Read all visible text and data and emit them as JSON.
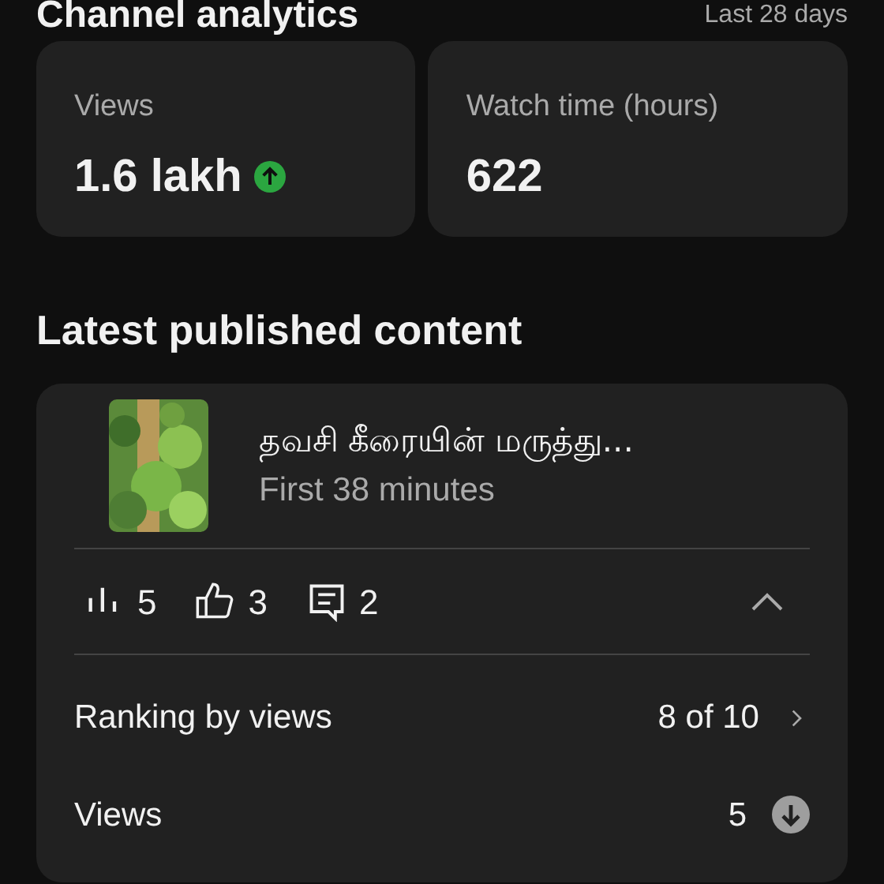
{
  "header": {
    "title": "Channel analytics",
    "period": "Last 28 days"
  },
  "summary_cards": [
    {
      "label": "Views",
      "value": "1.6 lakh",
      "kind": "increase"
    },
    {
      "label": "Watch time (hours)",
      "value": "622",
      "kind": "plain"
    }
  ],
  "latest": {
    "heading": "Latest published content",
    "video": {
      "title": "தவசி கீரையின் மருத்து...",
      "subtitle": "First 38 minutes"
    },
    "stats": [
      {
        "kind": "views",
        "value": "5"
      },
      {
        "kind": "likes",
        "value": "3"
      },
      {
        "kind": "comments",
        "value": "2"
      }
    ],
    "expanded": true,
    "rows": [
      {
        "label": "Ranking by views",
        "value": "8 of 10",
        "kind": "link"
      },
      {
        "label": "Views",
        "value": "5",
        "kind": "decrease"
      }
    ]
  }
}
